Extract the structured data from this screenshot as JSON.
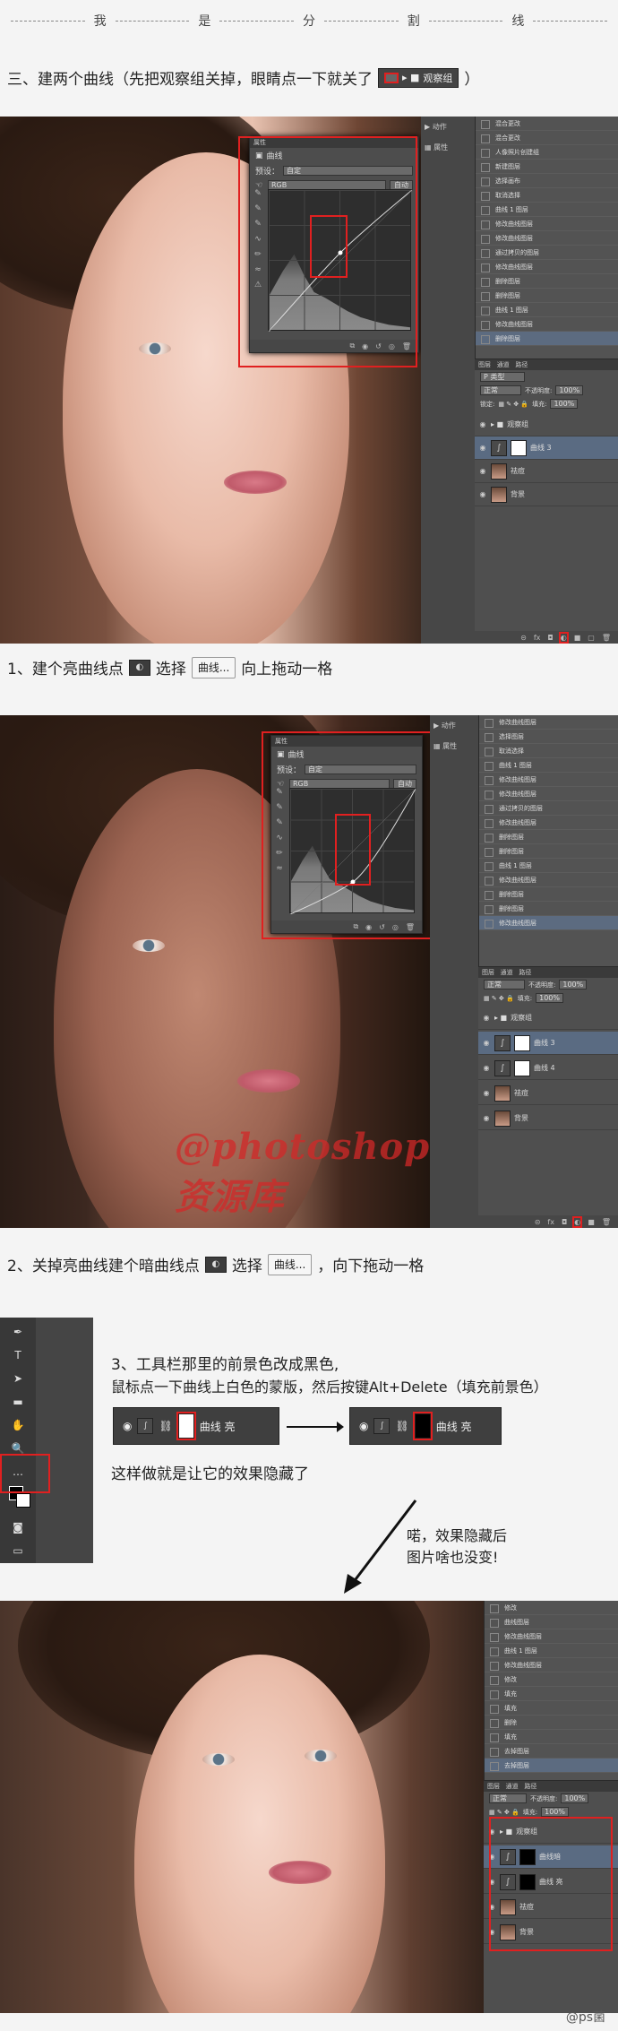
{
  "separator": {
    "chars": [
      "我",
      "是",
      "分",
      "割",
      "线"
    ]
  },
  "section3": {
    "heading": "三、建两个曲线（先把观察组关掉，眼睛点一下就关了",
    "heading_close": "）",
    "group_label": "观察组"
  },
  "shot1": {
    "properties_tab": "属性",
    "curves_title": "曲线",
    "preset_label": "预设：",
    "preset_value": "自定",
    "channel_value": "RGB",
    "auto_button": "自动",
    "history_items": [
      "混合更改",
      "混合更改",
      "人像照片创建组",
      "新建图层",
      "选择画布",
      "取消选择",
      "曲线 1 图层",
      "修改曲线图层",
      "修改曲线图层",
      "通过拷贝的图层",
      "修改曲线图层",
      "删除图层",
      "删除图层",
      "曲线 1 图层",
      "修改曲线图层",
      "删除图层"
    ],
    "layers_tabs": [
      "图层",
      "通道",
      "路径"
    ],
    "kind_label": "P 类型",
    "blend_mode": "正常",
    "opacity_label": "不透明度:",
    "opacity_value": "100%",
    "lock_label": "锁定:",
    "fill_label": "填充:",
    "fill_value": "100%",
    "layers": [
      {
        "name": "观察组",
        "type": "group"
      },
      {
        "name": "曲线 3",
        "type": "adj-white",
        "selected": true
      },
      {
        "name": "祛痘",
        "type": "photo"
      },
      {
        "name": "背景",
        "type": "photo"
      }
    ]
  },
  "step1": {
    "text_a": "1、建个亮曲线点",
    "text_b": "选择",
    "button": "曲线...",
    "text_c": "向上拖动一格"
  },
  "shot2": {
    "properties_tab": "属性",
    "curves_title": "曲线",
    "preset_label": "预设：",
    "preset_value": "自定",
    "channel_value": "RGB",
    "auto_button": "自动",
    "history_items": [
      "修改曲线图层",
      "选择图层",
      "取消选择",
      "曲线 1 图层",
      "修改曲线图层",
      "修改曲线图层",
      "通过拷贝的图层",
      "修改曲线图层",
      "删除图层",
      "删除图层",
      "曲线 1 图层",
      "修改曲线图层",
      "删除图层",
      "删除图层",
      "修改曲线图层"
    ],
    "blend_mode": "正常",
    "opacity_label": "不透明度:",
    "opacity_value": "100%",
    "fill_label": "填充:",
    "fill_value": "100%",
    "layers": [
      {
        "name": "观察组",
        "type": "group"
      },
      {
        "name": "曲线 3",
        "type": "adj-white",
        "selected": true
      },
      {
        "name": "曲线 4",
        "type": "adj-white"
      },
      {
        "name": "祛痘",
        "type": "photo"
      },
      {
        "name": "背景",
        "type": "photo"
      }
    ],
    "watermark": "@photoshop资源库"
  },
  "step2": {
    "text_a": "2、关掉亮曲线建个暗曲线点",
    "text_b": "选择",
    "button": "曲线...",
    "text_c": "，向下拖动一格"
  },
  "step3": {
    "line1": "3、工具栏那里的前景色改成黑色,",
    "line2": "鼠标点一下曲线上白色的蒙版，然后按键Alt+Delete（填充前景色）",
    "line3": "这样做就是让它的效果隐藏了",
    "demo_before_label": "曲线 亮",
    "demo_after_label": "曲线 亮",
    "note_line1": "喏，效果隐藏后",
    "note_line2": "图片啥也没变!"
  },
  "shot3": {
    "history_items": [
      "修改",
      "曲线图层",
      "修改曲线图层",
      "曲线 1 图层",
      "修改曲线图层",
      "修改",
      "填充",
      "填充",
      "删除",
      "填充",
      "去掉图层",
      "去掉图层"
    ],
    "blend_mode": "正常",
    "opacity_label": "不透明度:",
    "opacity_value": "100%",
    "fill_label": "填充:",
    "fill_value": "100%",
    "layers": [
      {
        "name": "观察组",
        "type": "group"
      },
      {
        "name": "曲线暗",
        "type": "adj-black",
        "selected": true
      },
      {
        "name": "曲线 亮",
        "type": "adj-black"
      },
      {
        "name": "祛痘",
        "type": "photo"
      },
      {
        "name": "背景",
        "type": "photo"
      }
    ]
  },
  "footer_watermark": "@ps菌"
}
